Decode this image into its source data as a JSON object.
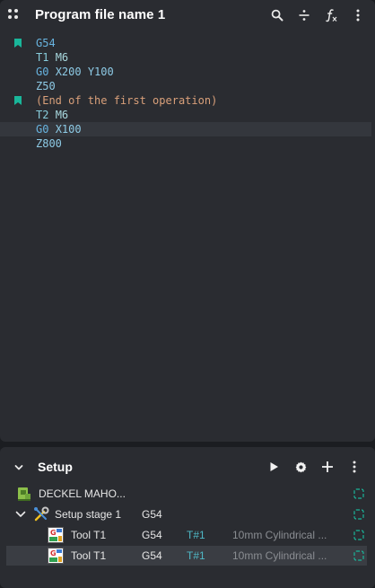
{
  "editor": {
    "title": "Program file name 1",
    "icons": [
      "drag-handle-icon",
      "search-icon",
      "divide-icon",
      "function-icon",
      "more-vertical-icon"
    ],
    "current_line_index": 6,
    "lines": [
      {
        "bookmarked": true,
        "tokens": [
          {
            "t": "G54",
            "c": "g"
          }
        ]
      },
      {
        "bookmarked": false,
        "tokens": [
          {
            "t": "T1",
            "c": "t"
          },
          {
            "t": " ",
            "c": "g"
          },
          {
            "t": "M6",
            "c": "m"
          }
        ]
      },
      {
        "bookmarked": false,
        "tokens": [
          {
            "t": "G0",
            "c": "g"
          },
          {
            "t": " ",
            "c": "g"
          },
          {
            "t": "X200",
            "c": "x"
          },
          {
            "t": " ",
            "c": "g"
          },
          {
            "t": "Y100",
            "c": "x"
          }
        ]
      },
      {
        "bookmarked": false,
        "tokens": [
          {
            "t": "Z50",
            "c": "x"
          }
        ]
      },
      {
        "bookmarked": true,
        "tokens": [
          {
            "t": "(End of the first operation)",
            "c": "comment"
          }
        ]
      },
      {
        "bookmarked": false,
        "tokens": [
          {
            "t": "T2",
            "c": "t"
          },
          {
            "t": " ",
            "c": "g"
          },
          {
            "t": "M6",
            "c": "m"
          }
        ]
      },
      {
        "bookmarked": false,
        "tokens": [
          {
            "t": "G0",
            "c": "g"
          },
          {
            "t": " ",
            "c": "g"
          },
          {
            "t": "X100",
            "c": "x"
          }
        ]
      },
      {
        "bookmarked": false,
        "tokens": [
          {
            "t": "Z800",
            "c": "x"
          }
        ]
      }
    ]
  },
  "setup": {
    "title": "Setup",
    "icons": [
      "play-icon",
      "gear-icon",
      "plus-icon",
      "more-vertical-icon"
    ],
    "machine": {
      "name": "DECKEL MAHO..."
    },
    "stage": {
      "name": "Setup stage 1",
      "wcs": "G54"
    },
    "tools": [
      {
        "name": "Tool T1",
        "wcs": "G54",
        "number": "T#1",
        "description": "10mm Cylindrical ...",
        "selected": false
      },
      {
        "name": "Tool T1",
        "wcs": "G54",
        "number": "T#1",
        "description": "10mm Cylindrical ...",
        "selected": true
      }
    ]
  },
  "colors": {
    "accent_teal": "#19b69a",
    "background": "#2a2c31"
  }
}
